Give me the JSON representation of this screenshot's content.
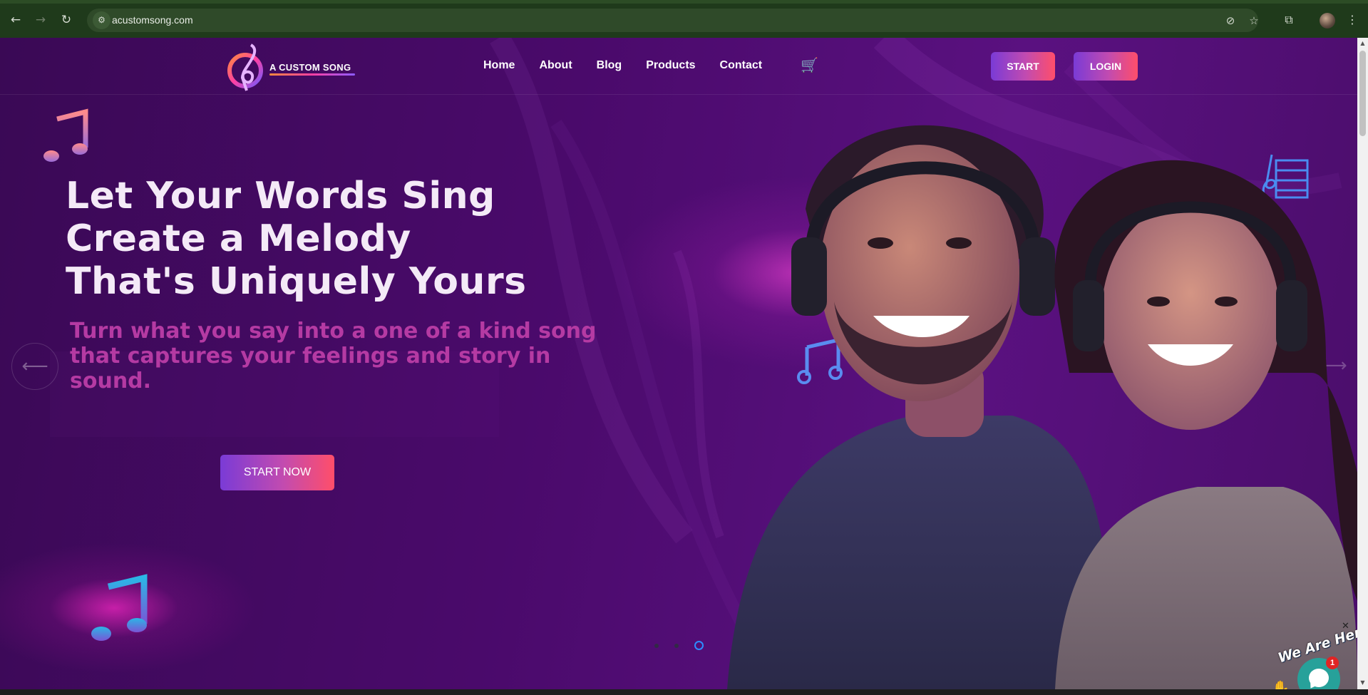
{
  "browser": {
    "url": "acustomsong.com",
    "icons": {
      "back": "arrow-left-icon",
      "forward": "arrow-right-icon",
      "reload": "reload-icon",
      "site_info": "tune-icon",
      "eye_off": "eye-off-icon",
      "bookmark": "star-icon",
      "extensions": "puzzle-icon",
      "menu": "kebab-menu-icon"
    }
  },
  "header": {
    "logo_text": "A CUSTOM SONG",
    "nav": [
      "Home",
      "About",
      "Blog",
      "Products",
      "Contact"
    ],
    "cart_icon": "cart-icon",
    "start_label": "START",
    "login_label": "LOGIN"
  },
  "hero": {
    "title_lines": [
      "Let Your Words Sing",
      "Create a Melody",
      "That's Uniquely Yours"
    ],
    "subtitle": "Turn what you say into a one of a kind song that captures your feelings and story in sound.",
    "cta_label": "START NOW",
    "prev_arrow": "⟵",
    "next_arrow": "⟶",
    "slides_count": 3,
    "active_slide": 3
  },
  "chat": {
    "label": "We Are Here!",
    "badge": "1",
    "close": "✕"
  },
  "colors": {
    "accent_purple": "#7a3bd6",
    "accent_pink": "#ff4e6a",
    "subtitle_magenta": "#b53aa3",
    "background": "#4a0a6b"
  }
}
